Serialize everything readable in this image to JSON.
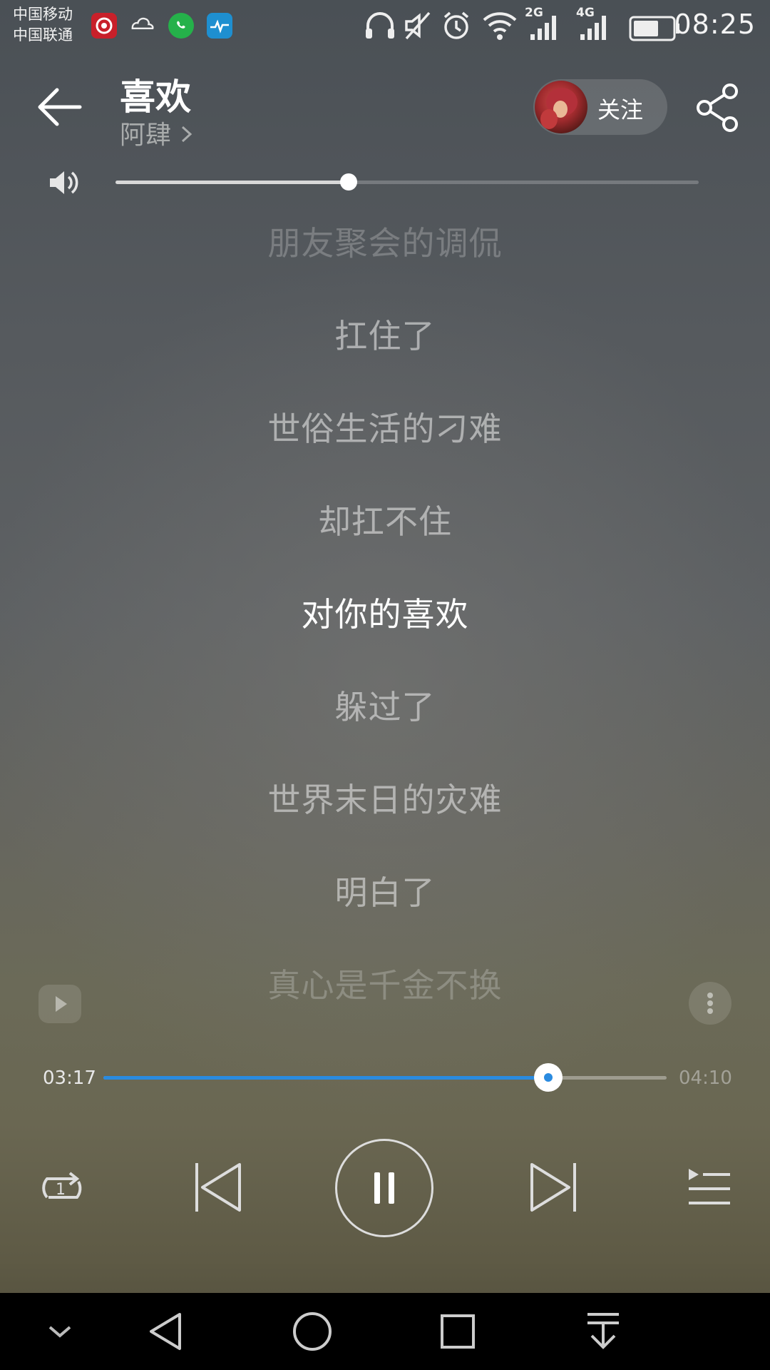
{
  "status_bar": {
    "carrier_1": "中国移动",
    "carrier_2": "中国联通",
    "app_icons": [
      "netease-music-icon",
      "cloud-icon",
      "whatsapp-icon",
      "health-icon"
    ],
    "network_1": "2G",
    "network_2": "4G",
    "time": "08:25"
  },
  "header": {
    "song_title": "喜欢",
    "artist": "阿肆",
    "follow_label": "关注"
  },
  "volume": {
    "level": 0.4
  },
  "lyrics": [
    {
      "text": "朋友聚会的调侃",
      "state": "faded"
    },
    {
      "text": "扛住了",
      "state": "normal"
    },
    {
      "text": "世俗生活的刁难",
      "state": "normal"
    },
    {
      "text": "却扛不住",
      "state": "normal"
    },
    {
      "text": "对你的喜欢",
      "state": "current"
    },
    {
      "text": "躲过了",
      "state": "normal"
    },
    {
      "text": "世界末日的灾难",
      "state": "normal"
    },
    {
      "text": "明白了",
      "state": "normal"
    },
    {
      "text": "真心是千金不换",
      "state": "faded"
    }
  ],
  "playback": {
    "elapsed": "03:17",
    "duration": "04:10",
    "progress": 0.79,
    "repeat_mode_badge": "1",
    "state": "playing"
  },
  "colors": {
    "accent": "#2a8be0"
  }
}
